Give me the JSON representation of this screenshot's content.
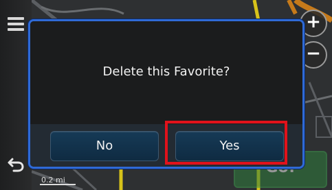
{
  "map": {
    "scale_label": "0.2 mi",
    "action_label": "Go!"
  },
  "controls": {
    "menu_icon": "menu-icon",
    "back_icon": "back-arrow-icon",
    "zoom_in_label": "+",
    "zoom_out_label": "−"
  },
  "dialog": {
    "message": "Delete this Favorite?",
    "no_label": "No",
    "yes_label": "Yes"
  },
  "colors": {
    "dialog_border": "#2f6ad6",
    "highlight": "#e1121b"
  }
}
